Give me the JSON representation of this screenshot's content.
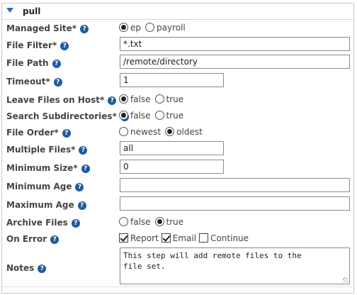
{
  "section": {
    "title": "pull"
  },
  "fields": {
    "managed_site": {
      "label": "Managed Site*",
      "options": [
        "ep",
        "payroll"
      ],
      "selected": "ep"
    },
    "file_filter": {
      "label": "File Filter*",
      "value": "*.txt"
    },
    "file_path": {
      "label": "File Path",
      "value": "/remote/directory"
    },
    "timeout": {
      "label": "Timeout*",
      "value": "1"
    },
    "leave_files": {
      "label": "Leave Files on Host*",
      "options": [
        "false",
        "true"
      ],
      "selected": "false"
    },
    "search_subdirs": {
      "label": "Search Subdirectories*",
      "options": [
        "false",
        "true"
      ],
      "selected": "false"
    },
    "file_order": {
      "label": "File Order*",
      "options": [
        "newest",
        "oldest"
      ],
      "selected": "oldest"
    },
    "multiple_files": {
      "label": "Multiple Files*",
      "value": "all"
    },
    "minimum_size": {
      "label": "Minimum Size*",
      "value": "0"
    },
    "minimum_age": {
      "label": "Minimum Age",
      "value": ""
    },
    "maximum_age": {
      "label": "Maximum Age",
      "value": ""
    },
    "archive_files": {
      "label": "Archive Files",
      "options": [
        "false",
        "true"
      ],
      "selected": "true"
    },
    "on_error": {
      "label": "On Error",
      "checks": [
        {
          "label": "Report",
          "checked": true
        },
        {
          "label": "Email",
          "checked": true
        },
        {
          "label": "Continue",
          "checked": false
        }
      ]
    },
    "notes": {
      "label": "Notes",
      "value": "This step will add remote files to the\nfile set."
    }
  },
  "help_icon": "question-mark-icon",
  "colors": {
    "accent": "#2a6ebb",
    "help": "#1f5aa0"
  }
}
